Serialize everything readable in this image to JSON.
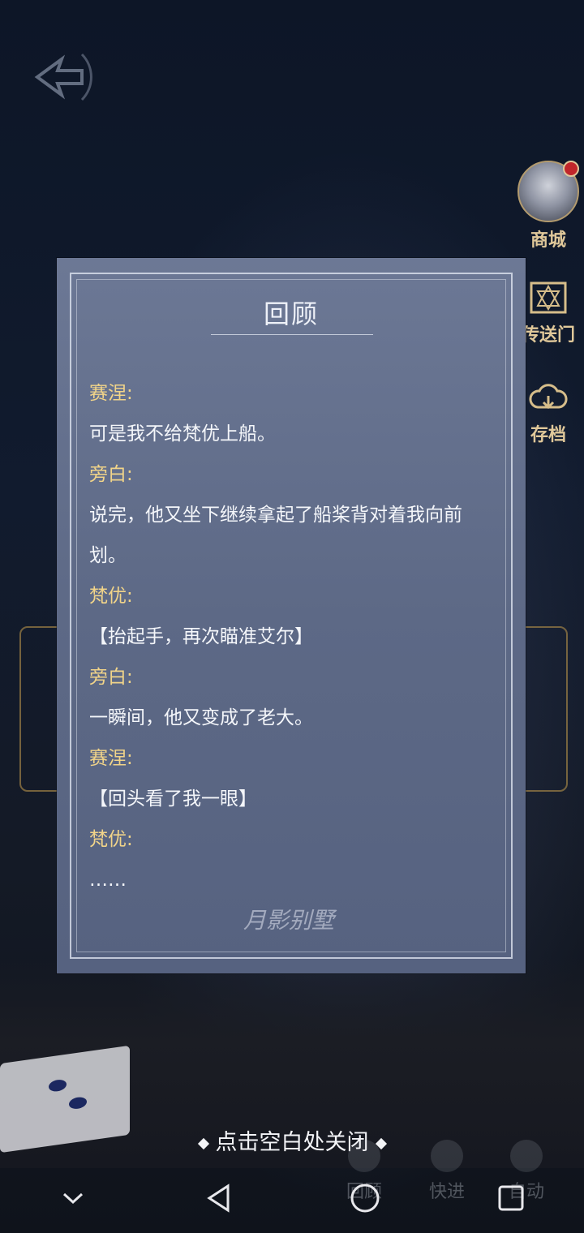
{
  "side_menu": {
    "shop_label": "商城",
    "portal_label": "传送门",
    "save_label": "存档"
  },
  "panel": {
    "title": "回顾",
    "logo_text": "月影别墅",
    "lines": [
      {
        "type": "speaker",
        "text": "赛涅:"
      },
      {
        "type": "dialogue",
        "text": "可是我不给梵优上船。"
      },
      {
        "type": "speaker",
        "text": "旁白:"
      },
      {
        "type": "dialogue",
        "text": "说完，他又坐下继续拿起了船桨背对着我向前"
      },
      {
        "type": "dialogue",
        "text": "划。"
      },
      {
        "type": "speaker",
        "text": "梵优:"
      },
      {
        "type": "dialogue",
        "text": "【抬起手，再次瞄准艾尔】"
      },
      {
        "type": "speaker",
        "text": "旁白:"
      },
      {
        "type": "dialogue",
        "text": "一瞬间，他又变成了老大。"
      },
      {
        "type": "speaker",
        "text": "赛涅:"
      },
      {
        "type": "dialogue",
        "text": "【回头看了我一眼】"
      },
      {
        "type": "speaker",
        "text": "梵优:"
      },
      {
        "type": "dialogue",
        "text": "……"
      }
    ]
  },
  "close_hint": "点击空白处关闭",
  "bottom_controls": {
    "review": "回顾",
    "fast": "快进",
    "auto": "自动"
  },
  "colors": {
    "speaker": "#f1d489",
    "dialogue": "#f4f6fa",
    "panel": "#66728f"
  }
}
